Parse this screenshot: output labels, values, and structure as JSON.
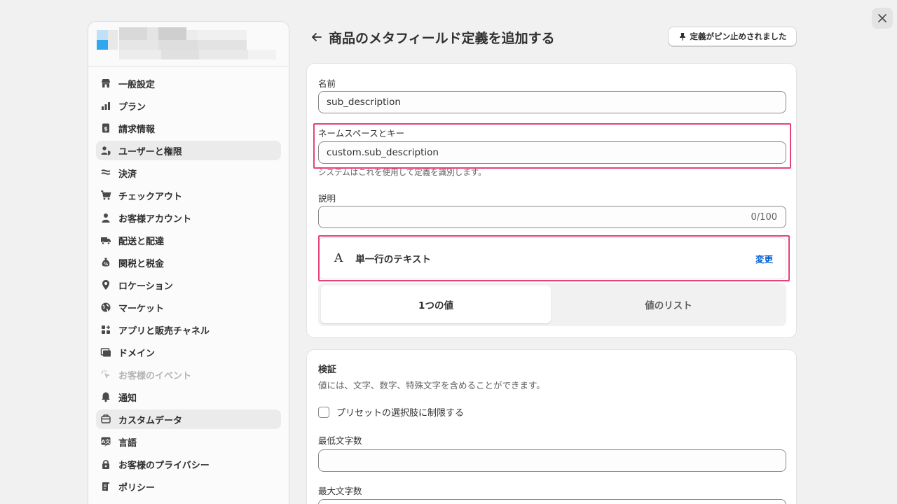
{
  "sidebar": {
    "items": [
      {
        "label": "一般設定",
        "icon": "store-icon",
        "active": false
      },
      {
        "label": "プラン",
        "icon": "plan-chart-icon",
        "active": false
      },
      {
        "label": "請求情報",
        "icon": "billing-icon",
        "active": false
      },
      {
        "label": "ユーザーと権限",
        "icon": "users-icon",
        "active": true
      },
      {
        "label": "決済",
        "icon": "payments-icon",
        "active": false
      },
      {
        "label": "チェックアウト",
        "icon": "cart-icon",
        "active": false
      },
      {
        "label": "お客様アカウント",
        "icon": "person-icon",
        "active": false
      },
      {
        "label": "配送と配達",
        "icon": "truck-icon",
        "active": false
      },
      {
        "label": "関税と税金",
        "icon": "tax-bag-icon",
        "active": false
      },
      {
        "label": "ロケーション",
        "icon": "location-pin-icon",
        "active": false
      },
      {
        "label": "マーケット",
        "icon": "globe-icon",
        "active": false
      },
      {
        "label": "アプリと販売チャネル",
        "icon": "apps-icon",
        "active": false
      },
      {
        "label": "ドメイン",
        "icon": "domain-icon",
        "active": false
      },
      {
        "label": "お客様のイベント",
        "icon": "cursor-click-icon",
        "active": false,
        "disabled": true
      },
      {
        "label": "通知",
        "icon": "bell-icon",
        "active": false
      },
      {
        "label": "カスタムデータ",
        "icon": "database-icon",
        "active": true
      },
      {
        "label": "言語",
        "icon": "language-icon",
        "active": false
      },
      {
        "label": "お客様のプライバシー",
        "icon": "lock-icon",
        "active": false
      },
      {
        "label": "ポリシー",
        "icon": "policy-icon",
        "active": false
      }
    ]
  },
  "header": {
    "title": "商品のメタフィールド定義を追加する",
    "pin_label": "定義がピン止めされました"
  },
  "form": {
    "name_label": "名前",
    "name_value": "sub_description",
    "namespace_label": "ネームスペースとキー",
    "namespace_value": "custom.sub_description",
    "namespace_help": "システムはこれを使用して定義を識別します。",
    "description_label": "説明",
    "description_counter": "0/100",
    "type_icon": "A",
    "type_name": "単一行のテキスト",
    "type_change": "変更",
    "option_single": "1つの値",
    "option_list": "値のリスト"
  },
  "validation": {
    "title": "検証",
    "description": "値には、文字、数字、特殊文字を含めることができます。",
    "preset_label": "プリセットの選択肢に制限する",
    "min_label": "最低文字数",
    "max_label": "最大文字数"
  },
  "colors": {
    "highlight": "#e6427a",
    "link": "#005bd3"
  }
}
